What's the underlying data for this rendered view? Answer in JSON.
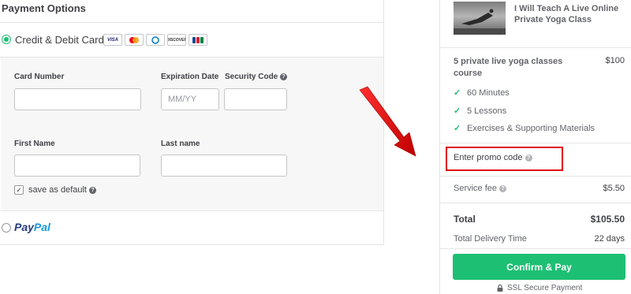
{
  "payment": {
    "title": "Payment Options",
    "methods": {
      "card_label": "Credit & Debit Cards",
      "paypal_p1": "Pay",
      "paypal_p2": "Pal"
    },
    "card_logos": [
      "VISA",
      "MC",
      "DC",
      "DISCOVER",
      "JCB"
    ],
    "form": {
      "card_number_label": "Card Number",
      "expiration_label": "Expiration Date",
      "expiration_placeholder": "MM/YY",
      "security_label": "Security Code",
      "first_name_label": "First Name",
      "last_name_label": "Last name",
      "save_default_label": "save as default"
    }
  },
  "summary": {
    "gig_title": "I Will Teach A Live Online Private Yoga Class",
    "package_name": "5 private live yoga classes course",
    "package_price": "$100",
    "features": [
      "60 Minutes",
      "5 Lessons",
      "Exercises & Supporting Materials"
    ],
    "promo_label": "Enter promo code",
    "service_fee_label": "Service fee",
    "service_fee_value": "$5.50",
    "total_label": "Total",
    "total_value": "$105.50",
    "delivery_label": "Total Delivery Time",
    "delivery_value": "22 days",
    "confirm_label": "Confirm & Pay",
    "ssl_label": "SSL Secure Payment"
  },
  "colors": {
    "accent_green": "#1dbf73",
    "highlight_red": "#e00000",
    "paypal_dark": "#253b80",
    "paypal_light": "#179bd7"
  },
  "icons": [
    "radio-icon",
    "help-icon",
    "check-icon",
    "lock-icon",
    "arrow-icon"
  ]
}
